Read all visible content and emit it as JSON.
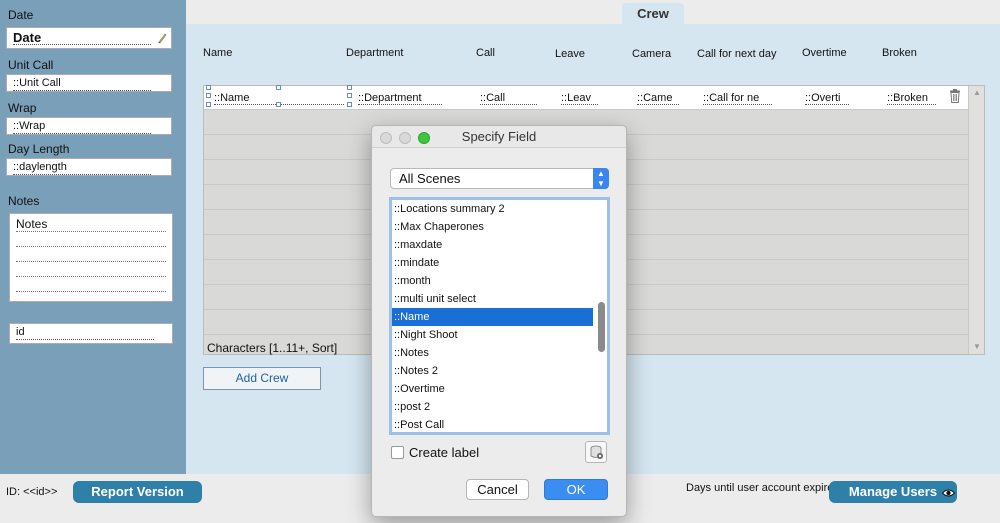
{
  "sidebar": {
    "date_label": "Date",
    "date_value": "Date",
    "unit_call_label": "Unit Call",
    "unit_call_value": "::Unit Call",
    "wrap_label": "Wrap",
    "wrap_value": "::Wrap",
    "day_length_label": "Day Length",
    "day_length_value": "::daylength",
    "notes_label": "Notes",
    "notes_value": "Notes",
    "id_value": "id"
  },
  "crew_tab": "Crew",
  "columns": [
    "Name",
    "Department",
    "Call",
    "Leave",
    "Camera",
    "Call for next day",
    "Overtime",
    "Broken"
  ],
  "row_cells": [
    "::Name",
    "::Department",
    "::Call",
    "::Leav",
    "::Came",
    "::Call for ne",
    "::Overti",
    "::Broken"
  ],
  "portal_footer": "Characters [1..11+, Sort]",
  "add_crew_label": "Add Crew",
  "footer": {
    "id_label": "ID: <<id>>",
    "report_version": "Report Version",
    "days_label": "Days until user account expire",
    "manage_users": "Manage Users"
  },
  "dialog": {
    "title": "Specify Field",
    "scope_selected": "All Scenes",
    "fields": [
      "::Locations summary 2",
      "::Max Chaperones",
      "::maxdate",
      "::mindate",
      "::month",
      "::multi unit select",
      "::Name",
      "::Night Shoot",
      "::Notes",
      "::Notes 2",
      "::Overtime",
      "::post 2",
      "::Post Call"
    ],
    "selected_field": "::Name",
    "create_label": "Create label",
    "cancel_label": "Cancel",
    "ok_label": "OK"
  },
  "colors": {
    "sidebar_bg": "#7a9fb8",
    "main_bg": "#d5e6f1",
    "pill_blue": "#2f80a8",
    "select_blue": "#1a6fd6",
    "ok_blue": "#3a8ef2"
  }
}
